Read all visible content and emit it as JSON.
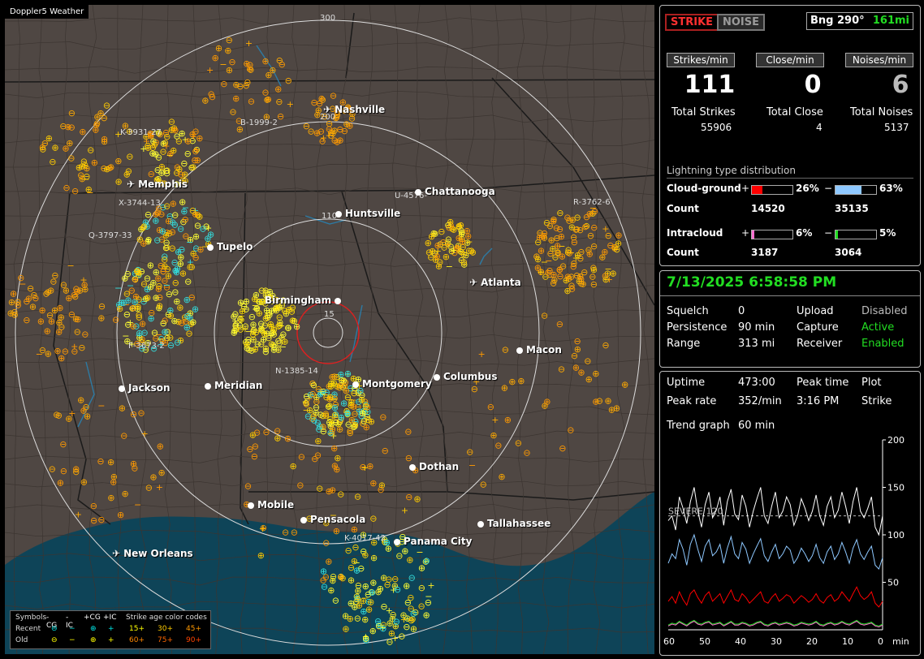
{
  "app": {
    "title": "Doppler5 Weather"
  },
  "status_tags": {
    "strike": "STRIKE",
    "noise": "NOISE",
    "bearing": "Bng 290°",
    "distance": "161mi"
  },
  "rates": {
    "strikes_label": "Strikes/min",
    "strikes_value": "111",
    "close_label": "Close/min",
    "close_value": "0",
    "noises_label": "Noises/min",
    "noises_value": "6"
  },
  "totals": {
    "strikes_label": "Total Strikes",
    "strikes_value": "55906",
    "close_label": "Total Close",
    "close_value": "4",
    "noises_label": "Total Noises",
    "noises_value": "5137"
  },
  "distribution": {
    "title": "Lightning type distribution",
    "cg_label": "Cloud-ground",
    "ic_label": "Intracloud",
    "count_label": "Count",
    "plus_sign": "+",
    "minus_sign": "−",
    "cg_pos_pct": "26%",
    "cg_neg_pct": "63%",
    "cg_pos_count": "14520",
    "cg_neg_count": "35135",
    "ic_pos_pct": "6%",
    "ic_neg_pct": "5%",
    "ic_pos_count": "3187",
    "ic_neg_count": "3064",
    "cg_pos_fill": 26,
    "cg_neg_fill": 63,
    "ic_pos_fill": 6,
    "ic_neg_fill": 5,
    "colors": {
      "cg_pos": "#ff0000",
      "cg_neg": "#8ec8ff",
      "ic_pos": "#ff6fd0",
      "ic_neg": "#22dd22"
    }
  },
  "settings": {
    "datetime": "7/13/2025 6:58:58 PM",
    "squelch_label": "Squelch",
    "squelch_value": "0",
    "persistence_label": "Persistence",
    "persistence_value": "90 min",
    "range_label": "Range",
    "range_value": "313 mi",
    "upload_label": "Upload",
    "upload_value": "Disabled",
    "capture_label": "Capture",
    "capture_value": "Active",
    "receiver_label": "Receiver",
    "receiver_value": "Enabled"
  },
  "stats": {
    "uptime_label": "Uptime",
    "uptime_value": "473:00",
    "peak_time_label": "Peak time",
    "peak_time_value": "3:16 PM",
    "plot_label": "Plot",
    "plot_value": "Strike",
    "peak_rate_label": "Peak rate",
    "peak_rate_value": "352/min",
    "trend_label": "Trend graph",
    "trend_value": "60 min"
  },
  "chart_data": {
    "type": "line",
    "x_ticks": [
      "60",
      "50",
      "40",
      "30",
      "20",
      "10",
      "0"
    ],
    "x_unit": "min",
    "y_ticks": [
      "200",
      "150",
      "100",
      "50"
    ],
    "ylim": [
      0,
      200
    ],
    "severe_label": "SEVERE 120",
    "severe_value": 120,
    "series": [
      {
        "color": "#ffffff",
        "values": [
          115,
          120,
          105,
          140,
          128,
          112,
          135,
          150,
          125,
          108,
          132,
          145,
          118,
          126,
          140,
          110,
          135,
          148,
          122,
          116,
          142,
          130,
          108,
          125,
          138,
          150,
          120,
          112,
          130,
          145,
          118,
          125,
          140,
          132,
          110,
          120,
          138,
          128,
          115,
          125,
          142,
          120,
          110,
          130,
          140,
          118,
          126,
          145,
          130,
          112,
          135,
          150,
          125,
          118,
          128,
          140,
          108,
          100,
          120
        ]
      },
      {
        "color": "#8ec8ff",
        "values": [
          70,
          80,
          75,
          95,
          85,
          68,
          90,
          100,
          85,
          72,
          88,
          95,
          78,
          82,
          90,
          70,
          86,
          98,
          80,
          75,
          92,
          85,
          70,
          80,
          88,
          96,
          78,
          72,
          82,
          90,
          75,
          80,
          88,
          84,
          70,
          76,
          86,
          80,
          72,
          78,
          90,
          76,
          70,
          82,
          88,
          74,
          80,
          92,
          82,
          70,
          86,
          95,
          80,
          74,
          82,
          88,
          68,
          64,
          76
        ]
      },
      {
        "color": "#ff0000",
        "values": [
          30,
          35,
          28,
          40,
          32,
          26,
          38,
          42,
          34,
          28,
          36,
          40,
          30,
          34,
          38,
          28,
          35,
          42,
          32,
          30,
          38,
          34,
          28,
          32,
          36,
          40,
          30,
          28,
          34,
          38,
          30,
          33,
          37,
          35,
          28,
          32,
          36,
          33,
          29,
          32,
          38,
          31,
          28,
          34,
          37,
          30,
          33,
          40,
          35,
          30,
          38,
          45,
          36,
          32,
          35,
          40,
          28,
          24,
          30
        ]
      },
      {
        "color": "#ff6fd0",
        "values": [
          4,
          6,
          5,
          8,
          6,
          4,
          7,
          9,
          6,
          5,
          7,
          8,
          5,
          6,
          7,
          4,
          6,
          8,
          5,
          5,
          7,
          6,
          4,
          5,
          7,
          8,
          5,
          4,
          6,
          7,
          5,
          6,
          7,
          6,
          4,
          5,
          7,
          6,
          5,
          6,
          8,
          5,
          4,
          6,
          7,
          5,
          6,
          8,
          6,
          5,
          7,
          9,
          6,
          5,
          6,
          7,
          4,
          3,
          5
        ]
      },
      {
        "color": "#22dd22",
        "values": [
          5,
          7,
          6,
          9,
          7,
          5,
          8,
          10,
          7,
          6,
          8,
          9,
          6,
          7,
          8,
          5,
          7,
          9,
          6,
          6,
          8,
          7,
          5,
          6,
          8,
          9,
          6,
          5,
          7,
          8,
          6,
          7,
          8,
          7,
          5,
          6,
          8,
          7,
          6,
          7,
          9,
          6,
          5,
          7,
          8,
          6,
          7,
          9,
          7,
          6,
          8,
          10,
          7,
          6,
          7,
          8,
          5,
          4,
          6
        ]
      }
    ]
  },
  "map": {
    "cities": [
      {
        "name": "Nashville",
        "icon": "airport-icon"
      },
      {
        "name": "Memphis",
        "icon": "airport-icon"
      },
      {
        "name": "Chattanooga",
        "icon": "dot-icon"
      },
      {
        "name": "Huntsville",
        "icon": "dot-icon"
      },
      {
        "name": "Tupelo",
        "icon": "dot-icon"
      },
      {
        "name": "Atlanta",
        "icon": "airport-icon"
      },
      {
        "name": "Birmingham",
        "icon": "dot-icon"
      },
      {
        "name": "Macon",
        "icon": "dot-icon"
      },
      {
        "name": "Jackson",
        "icon": "dot-icon"
      },
      {
        "name": "Meridian",
        "icon": "dot-icon"
      },
      {
        "name": "Montgomery",
        "icon": "dot-icon"
      },
      {
        "name": "Columbus",
        "icon": "dot-icon"
      },
      {
        "name": "Dothan",
        "icon": "dot-icon"
      },
      {
        "name": "Mobile",
        "icon": "dot-icon"
      },
      {
        "name": "Pensacola",
        "icon": "dot-icon"
      },
      {
        "name": "Tallahassee",
        "icon": "dot-icon"
      },
      {
        "name": "Panama City",
        "icon": "dot-icon"
      },
      {
        "name": "New Orleans",
        "icon": "airport-icon"
      }
    ],
    "range_labels": [
      "300",
      "200",
      "110",
      "15"
    ],
    "storm_labels": [
      "B-1999-2",
      "K-3931-27",
      "X-3744-13",
      "U-4576-",
      "R-3762-6",
      "Q-3797-33",
      "F-3673-2",
      "N-1385-14",
      "K-4017-42"
    ]
  },
  "legend": {
    "symbols_label": "Symbols",
    "cg_neg": "-CG",
    "ic_neg": "-IC",
    "cg_pos": "+CG",
    "ic_pos": "+IC",
    "age_label": "Strike age color codes",
    "recent_label": "Recent",
    "old_label": "Old",
    "age_15": "15+",
    "age_30": "30+",
    "age_45": "45+",
    "age_60": "60+",
    "age_75": "75+",
    "age_90": "90+"
  }
}
